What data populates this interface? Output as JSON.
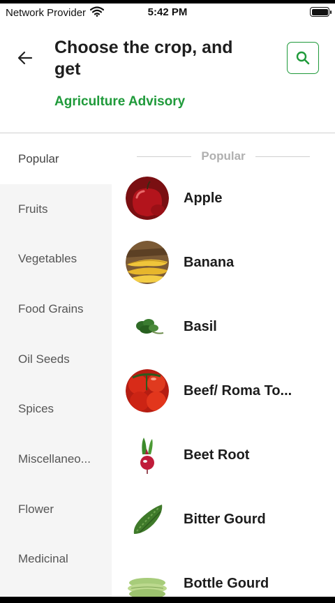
{
  "status_bar": {
    "carrier": "Network Provider",
    "time": "5:42 PM"
  },
  "header": {
    "title": "Choose the crop, and get",
    "subtitle": "Agriculture Advisory"
  },
  "sidebar": {
    "items": [
      {
        "label": "Popular"
      },
      {
        "label": "Fruits"
      },
      {
        "label": "Vegetables"
      },
      {
        "label": "Food Grains"
      },
      {
        "label": "Oil Seeds"
      },
      {
        "label": "Spices"
      },
      {
        "label": "Miscellaneo..."
      },
      {
        "label": "Flower"
      },
      {
        "label": "Medicinal"
      }
    ]
  },
  "main": {
    "section_label": "Popular",
    "crops": [
      {
        "name": "Apple",
        "icon": "apple-image"
      },
      {
        "name": "Banana",
        "icon": "banana-image"
      },
      {
        "name": "Basil",
        "icon": "basil-image"
      },
      {
        "name": "Beef/ Roma To...",
        "icon": "tomato-image"
      },
      {
        "name": "Beet Root",
        "icon": "beetroot-image"
      },
      {
        "name": "Bitter Gourd",
        "icon": "bitter-gourd-image"
      },
      {
        "name": "Bottle Gourd",
        "icon": "bottle-gourd-image"
      }
    ]
  },
  "colors": {
    "accent": "#1f9a3a",
    "sidebar_bg": "#f5f5f5"
  }
}
